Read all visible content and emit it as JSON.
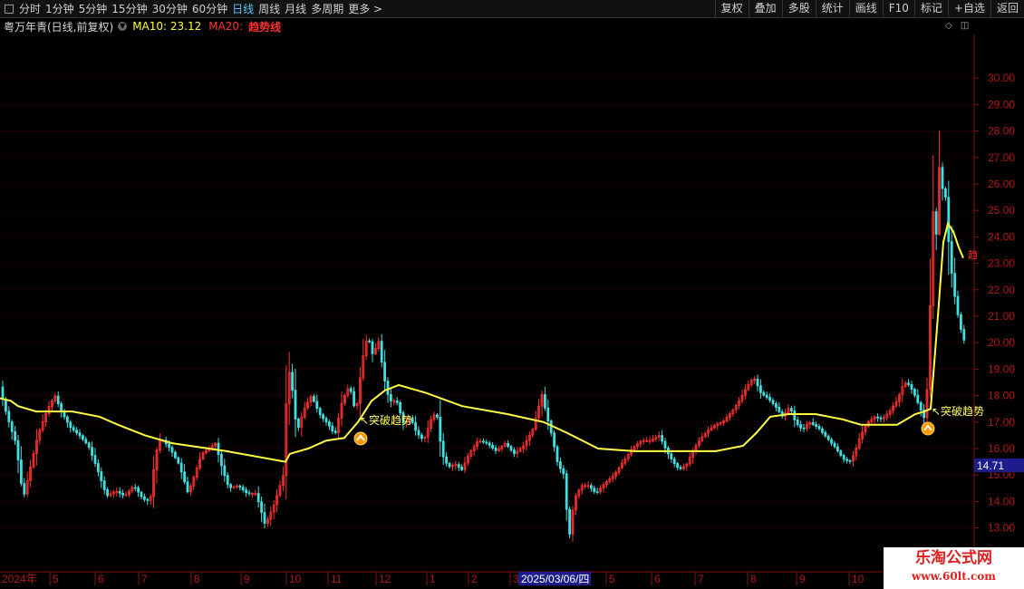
{
  "toolbar": {
    "periods": [
      "分时",
      "1分钟",
      "5分钟",
      "15分钟",
      "30分钟",
      "60分钟",
      "日线",
      "周线",
      "月线",
      "多周期",
      "更多 >"
    ],
    "active_period": "日线",
    "right_buttons": [
      "复权",
      "叠加",
      "多股",
      "统计",
      "画线",
      "F10",
      "标记",
      "+自选",
      "返回"
    ]
  },
  "info": {
    "stock": "粤万年青(日线,前复权)",
    "ma10": "MA10: 23.12",
    "ma20": "MA20:",
    "trend": "趋势线"
  },
  "signals": [
    {
      "label": "↖突破趋势",
      "icon": "up-arrow-badge-icon"
    },
    {
      "label": "↖突破趋势",
      "icon": "up-arrow-badge-icon"
    }
  ],
  "edge_label": "趋",
  "price_tag": "14.71",
  "date_highlight": "2025/03/06/四",
  "watermark": {
    "line1": "乐淘公式网",
    "line2": "www.60lt.com"
  },
  "colors": {
    "up": "#ff3030",
    "down": "#40e0e0",
    "trend": "#ffff40",
    "axis": "#8a1010",
    "grid": "#5a0000",
    "price_tag_bg": "#1c1c8c",
    "date_bg": "#1c1c8c"
  },
  "chart_data": {
    "type": "candlestick",
    "y_ticks": [
      13,
      14,
      15,
      16,
      17,
      18,
      19,
      20,
      21,
      22,
      23,
      24,
      25,
      26,
      27,
      28,
      29,
      30
    ],
    "ylim": [
      12.3,
      31.4
    ],
    "x_ticks": [
      "2024年",
      "5",
      "6",
      "7",
      "8",
      "9",
      "10",
      "11",
      "12",
      "1",
      "2",
      "3",
      "4",
      "5",
      "6",
      "7",
      "8",
      "9",
      "10"
    ],
    "trend_line": [
      [
        0,
        17.9
      ],
      [
        12,
        17.8
      ],
      [
        20,
        17.6
      ],
      [
        40,
        17.4
      ],
      [
        80,
        17.4
      ],
      [
        110,
        17.2
      ],
      [
        130,
        16.9
      ],
      [
        160,
        16.5
      ],
      [
        190,
        16.2
      ],
      [
        250,
        15.9
      ],
      [
        315,
        15.5
      ],
      [
        320,
        15.8
      ],
      [
        340,
        16.0
      ],
      [
        360,
        16.3
      ],
      [
        380,
        16.4
      ],
      [
        395,
        17.0
      ],
      [
        410,
        17.8
      ],
      [
        425,
        18.2
      ],
      [
        440,
        18.4
      ],
      [
        470,
        18.1
      ],
      [
        510,
        17.6
      ],
      [
        560,
        17.3
      ],
      [
        600,
        17.0
      ],
      [
        625,
        16.6
      ],
      [
        660,
        16.0
      ],
      [
        700,
        15.9
      ],
      [
        740,
        15.9
      ],
      [
        790,
        15.9
      ],
      [
        820,
        16.1
      ],
      [
        835,
        16.6
      ],
      [
        850,
        17.2
      ],
      [
        870,
        17.3
      ],
      [
        900,
        17.3
      ],
      [
        930,
        17.1
      ],
      [
        950,
        16.9
      ],
      [
        990,
        16.9
      ],
      [
        1010,
        17.3
      ],
      [
        1020,
        17.4
      ],
      [
        1027,
        17.5
      ],
      [
        1035,
        21.0
      ],
      [
        1041,
        23.8
      ],
      [
        1046,
        24.5
      ],
      [
        1052,
        24.2
      ],
      [
        1058,
        23.6
      ],
      [
        1063,
        23.2
      ]
    ],
    "price_path": [
      [
        0,
        18.6
      ],
      [
        8,
        17.5
      ],
      [
        14,
        16.8
      ],
      [
        20,
        16.2
      ],
      [
        28,
        14.1
      ],
      [
        36,
        15.3
      ],
      [
        44,
        16.5
      ],
      [
        55,
        17.5
      ],
      [
        63,
        18.0
      ],
      [
        70,
        17.4
      ],
      [
        80,
        16.8
      ],
      [
        90,
        16.5
      ],
      [
        100,
        16.1
      ],
      [
        110,
        15.2
      ],
      [
        120,
        14.2
      ],
      [
        130,
        14.4
      ],
      [
        140,
        14.2
      ],
      [
        150,
        14.6
      ],
      [
        160,
        14.1
      ],
      [
        168,
        14.0
      ],
      [
        174,
        15.8
      ],
      [
        180,
        16.4
      ],
      [
        190,
        16.0
      ],
      [
        200,
        15.4
      ],
      [
        210,
        14.3
      ],
      [
        218,
        15.1
      ],
      [
        225,
        15.8
      ],
      [
        233,
        16.0
      ],
      [
        240,
        16.2
      ],
      [
        248,
        15.2
      ],
      [
        255,
        14.5
      ],
      [
        265,
        14.6
      ],
      [
        275,
        14.3
      ],
      [
        285,
        14.3
      ],
      [
        295,
        13.1
      ],
      [
        305,
        13.9
      ],
      [
        315,
        15.0
      ],
      [
        320,
        19.2
      ],
      [
        325,
        18.2
      ],
      [
        330,
        16.6
      ],
      [
        338,
        17.5
      ],
      [
        346,
        18.0
      ],
      [
        355,
        17.3
      ],
      [
        365,
        16.9
      ],
      [
        372,
        16.5
      ],
      [
        380,
        17.8
      ],
      [
        388,
        18.4
      ],
      [
        395,
        17.3
      ],
      [
        402,
        19.3
      ],
      [
        408,
        20.3
      ],
      [
        414,
        19.5
      ],
      [
        420,
        20.1
      ],
      [
        426,
        18.7
      ],
      [
        432,
        17.8
      ],
      [
        440,
        17.8
      ],
      [
        448,
        16.9
      ],
      [
        455,
        17.2
      ],
      [
        462,
        16.6
      ],
      [
        470,
        16.3
      ],
      [
        478,
        17.1
      ],
      [
        484,
        17.4
      ],
      [
        490,
        15.8
      ],
      [
        497,
        15.3
      ],
      [
        505,
        15.4
      ],
      [
        512,
        15.2
      ],
      [
        520,
        15.8
      ],
      [
        530,
        16.3
      ],
      [
        540,
        16.2
      ],
      [
        550,
        15.9
      ],
      [
        560,
        16.2
      ],
      [
        570,
        15.8
      ],
      [
        580,
        16.1
      ],
      [
        590,
        16.7
      ],
      [
        597,
        17.6
      ],
      [
        600,
        18.1
      ],
      [
        606,
        17.2
      ],
      [
        612,
        16.4
      ],
      [
        618,
        15.4
      ],
      [
        625,
        15.0
      ],
      [
        630,
        12.5
      ],
      [
        636,
        14.1
      ],
      [
        644,
        14.6
      ],
      [
        652,
        14.6
      ],
      [
        660,
        14.3
      ],
      [
        670,
        14.7
      ],
      [
        680,
        15.0
      ],
      [
        690,
        15.5
      ],
      [
        700,
        16.0
      ],
      [
        710,
        16.3
      ],
      [
        720,
        16.3
      ],
      [
        730,
        16.5
      ],
      [
        738,
        15.9
      ],
      [
        745,
        15.5
      ],
      [
        752,
        15.2
      ],
      [
        760,
        15.4
      ],
      [
        768,
        16.0
      ],
      [
        776,
        16.4
      ],
      [
        784,
        16.7
      ],
      [
        792,
        16.9
      ],
      [
        800,
        17.0
      ],
      [
        810,
        17.4
      ],
      [
        818,
        17.8
      ],
      [
        826,
        18.3
      ],
      [
        834,
        18.7
      ],
      [
        842,
        18.1
      ],
      [
        850,
        17.9
      ],
      [
        858,
        17.6
      ],
      [
        866,
        17.2
      ],
      [
        874,
        17.6
      ],
      [
        880,
        17.0
      ],
      [
        888,
        16.7
      ],
      [
        895,
        17.0
      ],
      [
        905,
        16.8
      ],
      [
        915,
        16.4
      ],
      [
        925,
        16.0
      ],
      [
        933,
        15.6
      ],
      [
        940,
        15.5
      ],
      [
        945,
        15.8
      ],
      [
        952,
        16.5
      ],
      [
        960,
        17.0
      ],
      [
        968,
        17.2
      ],
      [
        976,
        17.1
      ],
      [
        984,
        17.4
      ],
      [
        992,
        17.8
      ],
      [
        1000,
        18.5
      ],
      [
        1006,
        18.4
      ],
      [
        1012,
        18.0
      ],
      [
        1018,
        17.5
      ],
      [
        1024,
        17.0
      ],
      [
        1028,
        20.5
      ],
      [
        1032,
        25.0
      ],
      [
        1036,
        24.0
      ],
      [
        1040,
        27.5
      ],
      [
        1043,
        25.4
      ],
      [
        1046,
        25.5
      ],
      [
        1050,
        23.4
      ],
      [
        1054,
        22.2
      ],
      [
        1058,
        21.3
      ],
      [
        1062,
        20.6
      ],
      [
        1066,
        20.1
      ]
    ]
  }
}
